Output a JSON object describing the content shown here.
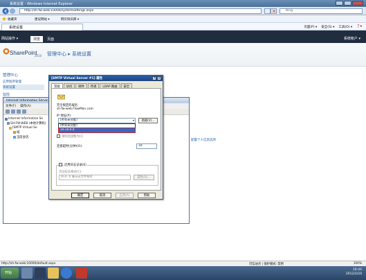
{
  "browser": {
    "title": "系统设置 - Windows Internet Explorer",
    "address": "http://sh-fw-web:10000/systemsettings.aspx",
    "search_placeholder": "Bing",
    "favorites_label": "收藏夹",
    "fav_links": [
      "建议网站 ▾",
      "网页快讯库 ▾"
    ],
    "tab_title": "系统设置",
    "tools": [
      "页面(P) ▾",
      "安全(S) ▾",
      "工具(O) ▾",
      "❓▾"
    ],
    "status_url": "http://sh-fw-web:10000/default.aspx",
    "status_zone": "可信站点 | 保护模式: 禁用",
    "zoom": "100%"
  },
  "sharepoint": {
    "site_actions": "网站操作 ▾",
    "ribbon_tabs": [
      "浏览",
      "页面"
    ],
    "user": "系统帐户 ▾",
    "logo": "SharePoint",
    "logo_version": "2010",
    "breadcrumb": "管理中心 ▸ 系统设置",
    "left_nav": {
      "heading": "管理中心",
      "items": [
        "应用程序管理",
        "系统设置",
        "监控"
      ],
      "active_index": 1
    },
    "personal_link": "配置个人信息选项"
  },
  "iis": {
    "title": "Internet Information Services (IIS) 6.0 管理器",
    "menu": [
      "文件(F)",
      "操作(A)"
    ],
    "tree": [
      "Internet Information Se",
      "SH-FW-WEB (本地计算机)",
      "[SMTP Virtual Se",
      "域",
      "当前会话"
    ]
  },
  "dialog": {
    "title": "[SMTP Virtual Server #1] 属性",
    "help_btn": "?",
    "close_btn": "×",
    "tabs": [
      "常规",
      "访问",
      "邮件",
      "传递",
      "LDAP 路由",
      "安全"
    ],
    "active_tab": 0,
    "fqdn_label": "完全限定的域名:",
    "fqdn_value": "sh-fw-web.FlowMan.com",
    "ip_label": "IP 地址(P):",
    "ip_selected": "(所有未分配)",
    "ip_options": [
      "(所有未分配)",
      "10.10.0.4"
    ],
    "advanced_btn": "高级(V)...",
    "limit_label": "限制连接数为(I):",
    "timeout_label": "连接超时(分钟)(O):",
    "timeout_value": "10",
    "logging_label": "启用日志记录(E)",
    "log_format_label": "活动日志格式(C):",
    "log_format_value": "W3C 扩展日志文件格式",
    "properties_btn": "属性(R)...",
    "ok_btn": "确定",
    "cancel_btn": "取消",
    "apply_btn": "应用(A)",
    "help_footer_btn": "帮助"
  },
  "taskbar": {
    "start": "开始",
    "time": "16:44",
    "date": "2012/2/24"
  }
}
